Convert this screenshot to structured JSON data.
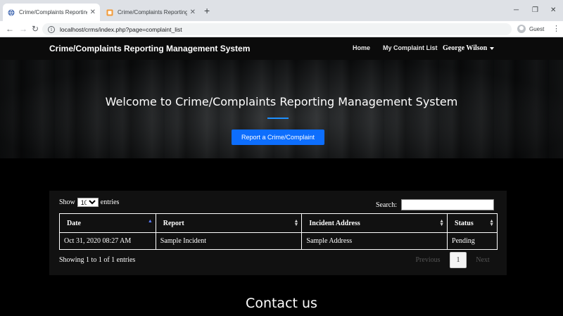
{
  "browser": {
    "tabs": [
      {
        "title": "Crime/Complaints Reporting Ma",
        "active": true
      },
      {
        "title": "Crime/Complaints Reporting Ma",
        "active": false
      }
    ],
    "new_tab_glyph": "+",
    "url": "localhost/crms/index.php?page=complaint_list",
    "profile_label": "Guest"
  },
  "site": {
    "brand": "Crime/Complaints Reporting Management System",
    "nav": {
      "home": "Home",
      "my_list": "My Complaint List",
      "user": "George Wilson"
    }
  },
  "hero": {
    "title": "Welcome to Crime/Complaints Reporting Management System",
    "button_label": "Report a Crime/Complaint",
    "accent": "#1e90ff"
  },
  "table_controls": {
    "show_label": "Show",
    "entries_value": "10",
    "entries_label": "entries",
    "search_label": "Search:"
  },
  "table": {
    "headers": [
      "Date",
      "Report",
      "Incident Address",
      "Status"
    ],
    "rows": [
      [
        "Oct 31, 2020 08:27 AM",
        "Sample Incident",
        "Sample Address",
        "Pending"
      ]
    ]
  },
  "footer_controls": {
    "info": "Showing 1 to 1 of 1 entries",
    "previous": "Previous",
    "current_page": "1",
    "next": "Next"
  },
  "contact_heading": "Contact us",
  "colors": {
    "primary_button": "#0d6efd",
    "page_background": "#000000"
  }
}
